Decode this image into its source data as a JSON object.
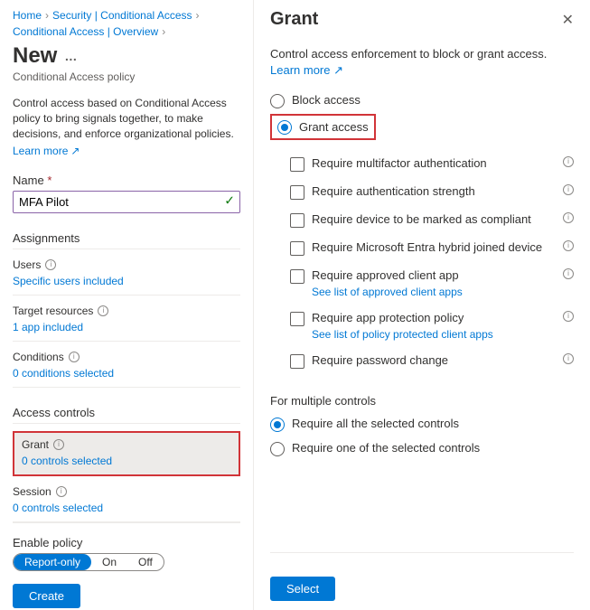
{
  "breadcrumb": {
    "home": "Home",
    "security": "Security | Conditional Access",
    "overview": "Conditional Access | Overview"
  },
  "page": {
    "title": "New",
    "subtitle": "Conditional Access policy",
    "description": "Control access based on Conditional Access policy to bring signals together, to make decisions, and enforce organizational policies.",
    "learn_more": "Learn more"
  },
  "name": {
    "label": "Name",
    "value": "MFA Pilot"
  },
  "sections": {
    "assignments": "Assignments",
    "users_label": "Users",
    "users_link": "Specific users included",
    "target_label": "Target resources",
    "target_link": "1 app included",
    "conditions_label": "Conditions",
    "conditions_link": "0 conditions selected",
    "access_controls": "Access controls",
    "grant_label": "Grant",
    "grant_link": "0 controls selected",
    "session_label": "Session",
    "session_link": "0 controls selected"
  },
  "enable": {
    "label": "Enable policy",
    "opt_report": "Report-only",
    "opt_on": "On",
    "opt_off": "Off",
    "create": "Create"
  },
  "panel": {
    "title": "Grant",
    "desc": "Control access enforcement to block or grant access.",
    "learn_more": "Learn more",
    "block": "Block access",
    "grant": "Grant access",
    "checks": {
      "mfa": "Require multifactor authentication",
      "strength": "Require authentication strength",
      "compliant": "Require device to be marked as compliant",
      "hybrid": "Require Microsoft Entra hybrid joined device",
      "approved_app": "Require approved client app",
      "approved_link": "See list of approved client apps",
      "protection": "Require app protection policy",
      "protection_link": "See list of policy protected client apps",
      "password": "Require password change"
    },
    "multi_label": "For multiple controls",
    "require_all": "Require all the selected controls",
    "require_one": "Require one of the selected controls",
    "select": "Select"
  }
}
